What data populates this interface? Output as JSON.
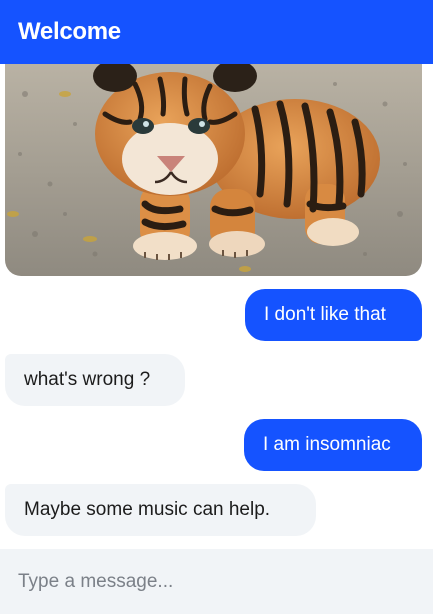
{
  "header": {
    "title": "Welcome"
  },
  "image": {
    "subject": "tiger cub photo"
  },
  "messages": [
    {
      "sender": "user",
      "text": "I don't like that"
    },
    {
      "sender": "bot",
      "text": "what's wrong ?"
    },
    {
      "sender": "user",
      "text": "I am insomniac"
    },
    {
      "sender": "bot",
      "text": "Maybe some music can help."
    }
  ],
  "composer": {
    "placeholder": "Type a message...",
    "value": ""
  },
  "colors": {
    "accent": "#1553ff",
    "bot_bubble": "#f1f4f7",
    "composer_bg": "#f1f4f7"
  }
}
